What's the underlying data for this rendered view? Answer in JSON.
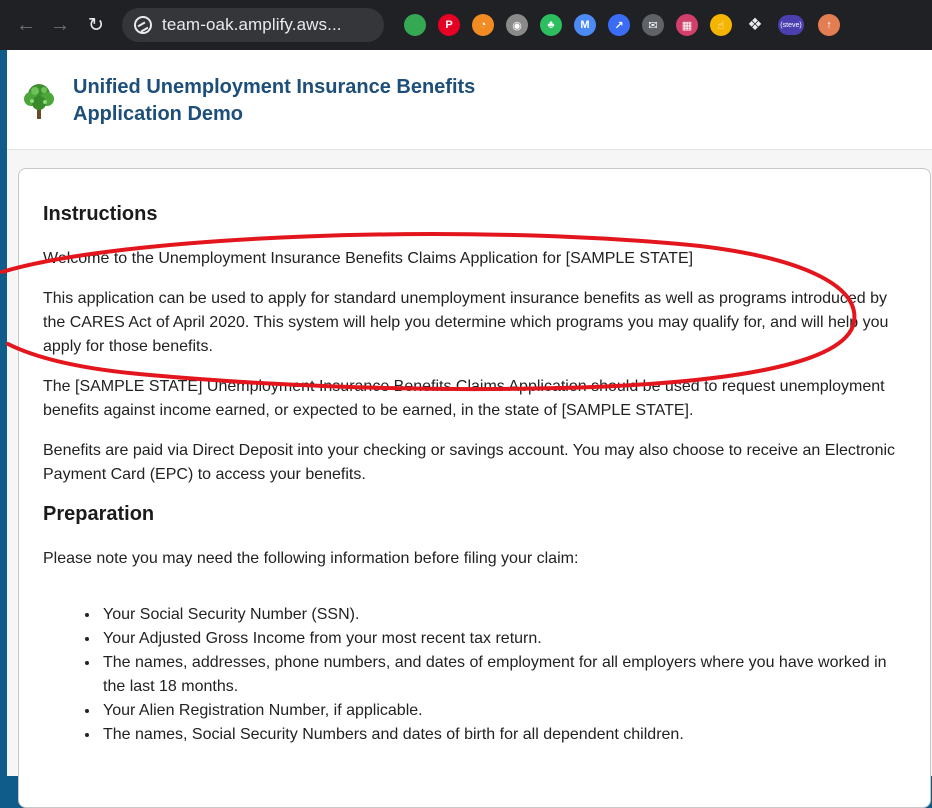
{
  "browser": {
    "url": "team-oak.amplify.aws...",
    "extensions": [
      {
        "name": "green-dot-extension-icon",
        "color": "#34a853",
        "glyph": ""
      },
      {
        "name": "pinterest-icon",
        "color": "#e60023",
        "glyph": "P"
      },
      {
        "name": "rss-icon",
        "color": "#f28b22",
        "glyph": "◔"
      },
      {
        "name": "record-icon",
        "color": "#8a8a8a",
        "glyph": "◉"
      },
      {
        "name": "evernote-icon",
        "color": "#2dbe60",
        "glyph": "♣"
      },
      {
        "name": "mailtrack-icon",
        "color": "#4c8bf5",
        "glyph": "M"
      },
      {
        "name": "blue-arrow-extension-icon",
        "color": "#3b6cf6",
        "glyph": "↗"
      },
      {
        "name": "mail-icon",
        "color": "#5f6368",
        "glyph": "✉"
      },
      {
        "name": "grid-extension-icon",
        "color": "#d23f6b",
        "glyph": "▦"
      },
      {
        "name": "thumbs-up-icon",
        "color": "#f4b400",
        "glyph": "☝"
      },
      {
        "name": "puzzle-extensions-icon",
        "color": "#202124",
        "glyph": "❖"
      }
    ],
    "profile_label": "(steve)",
    "update_icon_color": "#e37d52"
  },
  "header": {
    "title_line1": "Unified Unemployment Insurance Benefits",
    "title_line2": "Application Demo"
  },
  "instructions": {
    "heading": "Instructions",
    "p1": "Welcome to the Unemployment Insurance Benefits Claims Application for [SAMPLE STATE]",
    "p2": "This application can be used to apply for standard unemployment insurance benefits as well as programs introduced by the CARES Act of April 2020. This system will help you determine which programs you may qualify for, and will help you apply for those benefits.",
    "p3": "The [SAMPLE STATE] Unemployment Insurance Benefits Claims Application should be used to request unemployment benefits against income earned, or expected to be earned, in the state of [SAMPLE STATE].",
    "p4": "Benefits are paid via Direct Deposit into your checking or savings account. You may also choose to receive an Electronic Payment Card (EPC) to access your benefits."
  },
  "preparation": {
    "heading": "Preparation",
    "intro": "Please note you may need the following information before filing your claim:",
    "items": [
      "Your Social Security Number (SSN).",
      "Your Adjusted Gross Income from your most recent tax return.",
      "The names, addresses, phone numbers, and dates of employment for all employers where you have worked in the last 18 months.",
      "Your Alien Registration Number, if applicable.",
      "The names, Social Security Numbers and dates of birth for all dependent children."
    ]
  },
  "colors": {
    "title": "#1d4f7a",
    "annotation": "#e3151d",
    "page_frame": "#0f5c8a"
  }
}
